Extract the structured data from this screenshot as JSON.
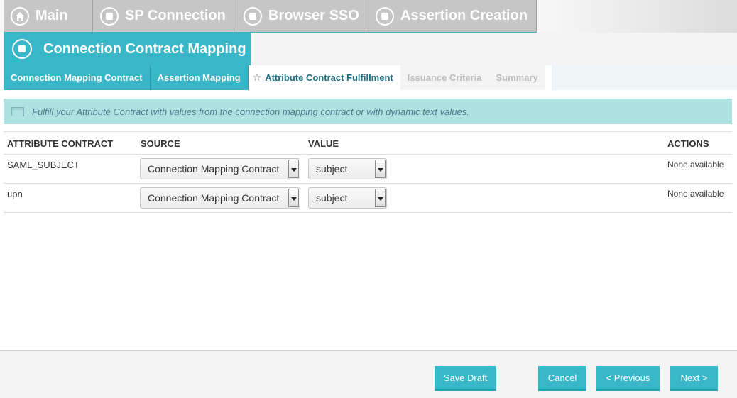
{
  "breadcrumbs": [
    {
      "label": "Main",
      "icon": "home-icon"
    },
    {
      "label": "SP Connection",
      "icon": "circle-square-icon"
    },
    {
      "label": "Browser SSO",
      "icon": "circle-square-icon"
    },
    {
      "label": "Assertion Creation",
      "icon": "circle-square-icon"
    }
  ],
  "section": {
    "title": "Connection Contract Mapping",
    "icon": "circle-square-icon"
  },
  "subtabs": [
    {
      "label": "Connection Mapping Contract",
      "state": "done"
    },
    {
      "label": "Assertion Mapping",
      "state": "done"
    },
    {
      "label": "Attribute Contract Fulfillment",
      "state": "active"
    },
    {
      "label": "Issuance Criteria",
      "state": "future"
    },
    {
      "label": "Summary",
      "state": "future"
    }
  ],
  "banner": {
    "text": "Fulfill your Attribute Contract with values from the connection mapping contract or with dynamic text values."
  },
  "table": {
    "headers": {
      "attribute": "ATTRIBUTE CONTRACT",
      "source": "SOURCE",
      "value": "VALUE",
      "actions": "ACTIONS"
    },
    "rows": [
      {
        "attribute": "SAML_SUBJECT",
        "source": "Connection Mapping Contract",
        "value": "subject",
        "actions": "None available"
      },
      {
        "attribute": "upn",
        "source": "Connection Mapping Contract",
        "value": "subject",
        "actions": "None available"
      }
    ]
  },
  "footer": {
    "save_draft": "Save Draft",
    "cancel": "Cancel",
    "previous": "< Previous",
    "next": "Next >"
  },
  "colors": {
    "accent": "#3ab6c9",
    "banner": "#aee2e0",
    "crumb": "#c6c6c6"
  }
}
